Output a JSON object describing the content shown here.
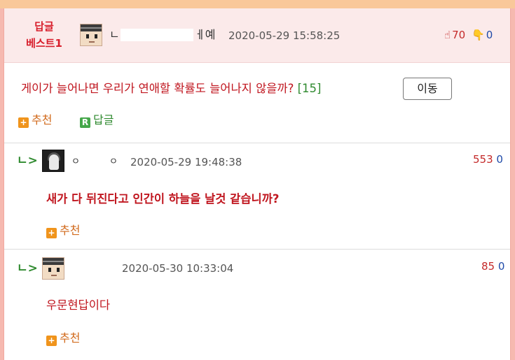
{
  "best_reply": {
    "badge_line1": "답글",
    "badge_line2": "베스트1",
    "username_visible_start": "ㄴ",
    "username_visible_end": "ㅔ예",
    "timestamp": "2020-05-29 15:58:25",
    "upvotes": "70",
    "downvotes": "0",
    "question_text": "게이가 늘어나면 우리가 연애할 확률도 늘어나지 않을까?",
    "comment_count": "[15]",
    "move_button_label": "이동",
    "recommend_label": "추천",
    "reply_label": "답글",
    "recommend_icon": "+",
    "reply_icon": "R"
  },
  "replies": [
    {
      "username_visible_start": "ㅇ",
      "username_visible_end": "ㅇ",
      "timestamp": "2020-05-29 19:48:38",
      "upvotes": "553",
      "downvotes": "0",
      "text": "새가 다 뒤진다고 인간이 하늘을 날것 같습니까?",
      "recommend_label": "추천",
      "recommend_icon": "+"
    },
    {
      "username_visible_start": "",
      "username_visible_end": "",
      "timestamp": "2020-05-30 10:33:04",
      "upvotes": "85",
      "downvotes": "0",
      "text": "우문현답이다",
      "recommend_label": "추천",
      "recommend_icon": "+"
    }
  ],
  "icons": {
    "reply_arrow": "ㄴ>",
    "thumb_up": "👍",
    "thumb_down": "👎"
  },
  "colors": {
    "accent_red": "#c0161f",
    "accent_green": "#2f8a2f",
    "accent_orange": "#f0941c",
    "downvote_blue": "#1f4aa8",
    "best_bg": "#fbeaea",
    "frame_pink": "#f6b9b0"
  }
}
